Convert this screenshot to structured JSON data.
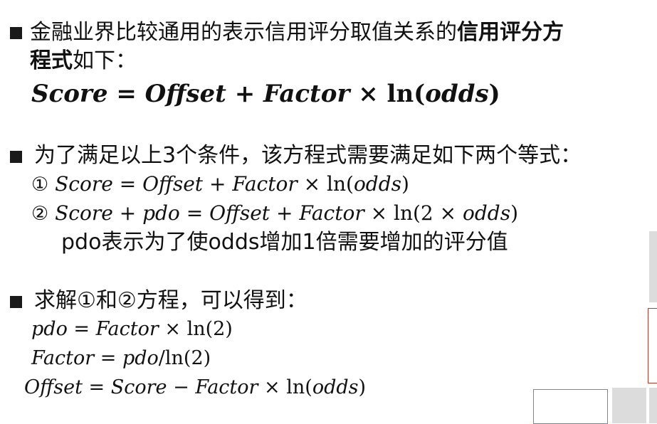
{
  "section1": {
    "text_regular": "金融业界比较通用的表示信用评分取值关系的",
    "text_bold": "信用评分方",
    "line2_bold": "程式",
    "line2_regular": "如下：",
    "equation": {
      "score": "Score",
      "eq": " = ",
      "offset": "Offset",
      "plus": " + ",
      "factor": "Factor",
      "times": " × ",
      "ln": "ln",
      "lp": "(",
      "odds": "odds",
      "rp": ")"
    }
  },
  "section2": {
    "text": "为了满足以上3个条件，该方程式需要满足如下两个等式：",
    "eq1": {
      "marker": "①",
      "lhs": "Score",
      "eq": " = ",
      "offset": "Offset",
      "plus": " + ",
      "factor": "Factor",
      "times": " × ",
      "ln": "ln",
      "arg_open": "(",
      "arg": "odds",
      "arg_close": ")"
    },
    "eq2": {
      "marker": "②",
      "lhs": "Score",
      "plus1": " + ",
      "pdo": "pdo",
      "eq": " = ",
      "offset": "Offset",
      "plus2": " + ",
      "factor": "Factor",
      "times": " × ",
      "ln": "ln",
      "arg_open": "(2",
      "times2": " × ",
      "arg": "odds",
      "arg_close": ")"
    },
    "note": "pdo表示为了使odds增加1倍需要增加的评分值"
  },
  "section3": {
    "text": "求解①和②方程，可以得到：",
    "eqA": {
      "pdo": "pdo",
      "eq": " = ",
      "factor": "Factor",
      "times": " × ",
      "ln": "ln",
      "arg": "(2)"
    },
    "eqB": {
      "factor": "Factor",
      "eq": " = ",
      "pdo": "pdo",
      "slash": "/",
      "ln": "ln",
      "arg": "(2)"
    },
    "eqC": {
      "offset": "Offset",
      "eq": " = ",
      "score": "Score",
      "minus": " − ",
      "factor": "Factor",
      "times": " × ",
      "ln": "ln",
      "lp": "(",
      "odds": "odds",
      "rp": ")"
    }
  }
}
